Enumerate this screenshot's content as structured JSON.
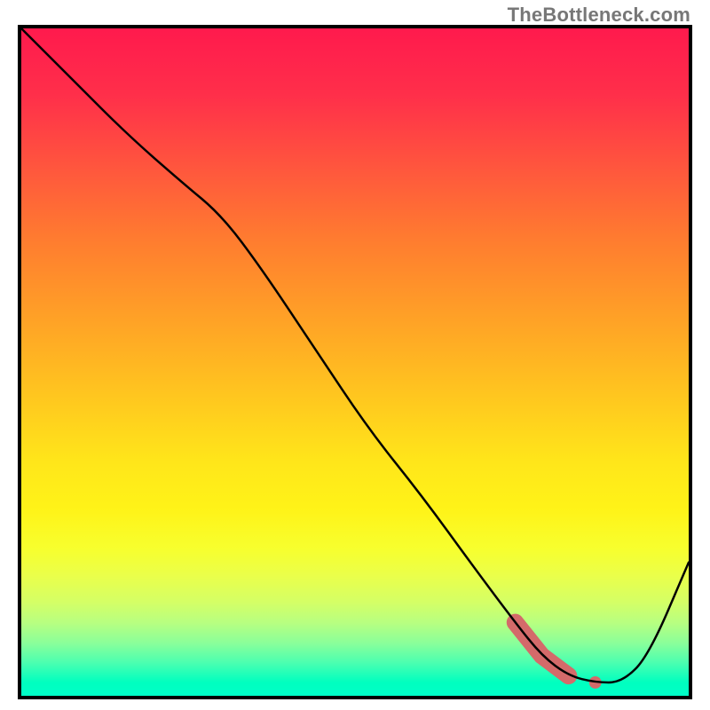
{
  "watermark": "TheBottleneck.com",
  "chart_data": {
    "type": "line",
    "title": "",
    "xlabel": "",
    "ylabel": "",
    "xlim": [
      0,
      100
    ],
    "ylim": [
      0,
      100
    ],
    "grid": false,
    "legend": false,
    "series": [
      {
        "name": "curve",
        "color": "#000000",
        "x": [
          0,
          8,
          16,
          24,
          30,
          36,
          44,
          52,
          60,
          68,
          74,
          78,
          82,
          86,
          90,
          94,
          100
        ],
        "values": [
          100,
          92,
          84,
          77,
          72,
          64,
          52,
          40,
          30,
          19,
          11,
          6,
          3,
          2,
          2,
          6,
          20
        ]
      }
    ],
    "markers": [
      {
        "name": "thick-segment",
        "from_index": 10,
        "to_index": 12,
        "color": "#d46a6a",
        "width": 14
      },
      {
        "name": "dot-a",
        "at_index": 12,
        "color": "#d46a6a",
        "r": 7
      },
      {
        "name": "dot-b",
        "at_index": 13,
        "color": "#d46a6a",
        "r": 7
      }
    ],
    "gradient_stops": [
      {
        "pos": 0,
        "color": "#ff1a4d"
      },
      {
        "pos": 100,
        "color": "#00ffc8"
      }
    ]
  }
}
